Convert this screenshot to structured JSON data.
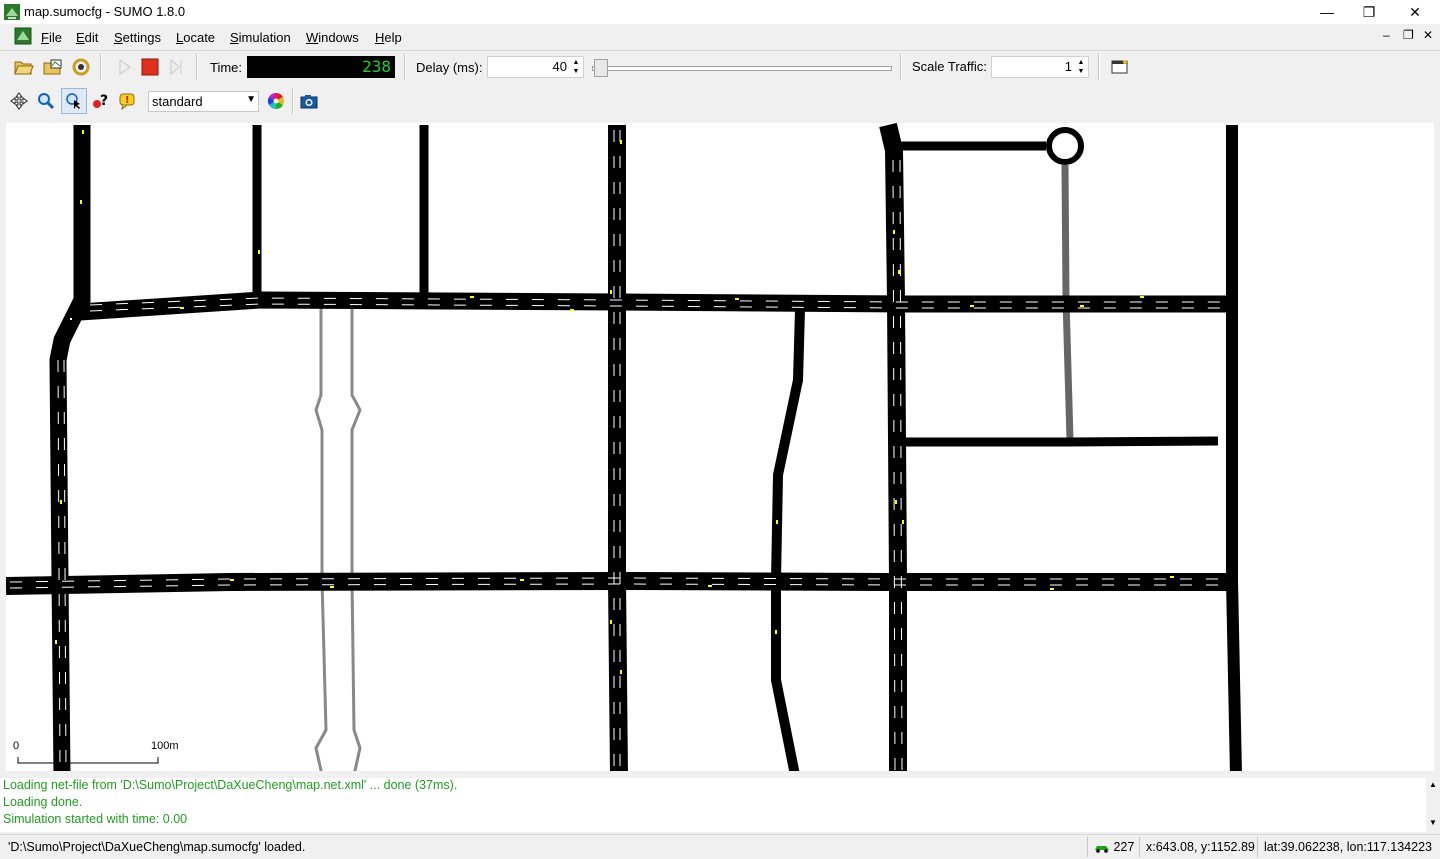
{
  "window": {
    "title": "map.sumocfg - SUMO 1.8.0",
    "minimize": "—",
    "maximize": "❐",
    "close": "✕"
  },
  "menu": {
    "items": [
      {
        "label": "File"
      },
      {
        "label": "Edit"
      },
      {
        "label": "Settings"
      },
      {
        "label": "Locate"
      },
      {
        "label": "Simulation"
      },
      {
        "label": "Windows"
      },
      {
        "label": "Help"
      }
    ],
    "mdi_controls": [
      "–",
      "❐",
      "✕"
    ]
  },
  "toolbar": {
    "time_label": "Time:",
    "time_value": "238",
    "delay_label": "Delay (ms):",
    "delay_value": "40",
    "scale_label": "Scale Traffic:",
    "scale_value": "1",
    "play_icon": "play-icon",
    "stop_icon": "stop-icon",
    "step_icon": "step-icon"
  },
  "view_toolbar": {
    "scheme": "standard"
  },
  "canvas": {
    "scale_zero": "0",
    "scale_label": "100m",
    "road_color": "#000000",
    "lane_mark_color": "#ffffff",
    "vehicle_color": "#ffff00",
    "ped_path_color": "#808080"
  },
  "log": {
    "lines": [
      "Loading net-file from 'D:\\Sumo\\Project\\DaXueCheng\\map.net.xml' ... done (37ms).",
      "Loading done.",
      "Simulation started with time: 0.00"
    ],
    "color": "#1f9e1f"
  },
  "status": {
    "message": "'D:\\Sumo\\Project\\DaXueCheng\\map.sumocfg' loaded.",
    "vehicle_count": "227",
    "xy": "x:643.08, y:1152.89",
    "latlon": "lat:39.062238, lon:117.134223"
  }
}
